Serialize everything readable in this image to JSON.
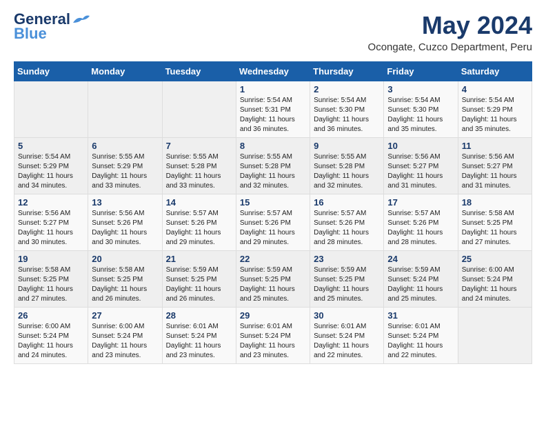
{
  "header": {
    "logo_line1": "General",
    "logo_line2": "Blue",
    "month_year": "May 2024",
    "location": "Ocongate, Cuzco Department, Peru"
  },
  "days_of_week": [
    "Sunday",
    "Monday",
    "Tuesday",
    "Wednesday",
    "Thursday",
    "Friday",
    "Saturday"
  ],
  "weeks": [
    [
      {
        "day": "",
        "info": ""
      },
      {
        "day": "",
        "info": ""
      },
      {
        "day": "",
        "info": ""
      },
      {
        "day": "1",
        "info": "Sunrise: 5:54 AM\nSunset: 5:31 PM\nDaylight: 11 hours\nand 36 minutes."
      },
      {
        "day": "2",
        "info": "Sunrise: 5:54 AM\nSunset: 5:30 PM\nDaylight: 11 hours\nand 36 minutes."
      },
      {
        "day": "3",
        "info": "Sunrise: 5:54 AM\nSunset: 5:30 PM\nDaylight: 11 hours\nand 35 minutes."
      },
      {
        "day": "4",
        "info": "Sunrise: 5:54 AM\nSunset: 5:29 PM\nDaylight: 11 hours\nand 35 minutes."
      }
    ],
    [
      {
        "day": "5",
        "info": "Sunrise: 5:54 AM\nSunset: 5:29 PM\nDaylight: 11 hours\nand 34 minutes."
      },
      {
        "day": "6",
        "info": "Sunrise: 5:55 AM\nSunset: 5:29 PM\nDaylight: 11 hours\nand 33 minutes."
      },
      {
        "day": "7",
        "info": "Sunrise: 5:55 AM\nSunset: 5:28 PM\nDaylight: 11 hours\nand 33 minutes."
      },
      {
        "day": "8",
        "info": "Sunrise: 5:55 AM\nSunset: 5:28 PM\nDaylight: 11 hours\nand 32 minutes."
      },
      {
        "day": "9",
        "info": "Sunrise: 5:55 AM\nSunset: 5:28 PM\nDaylight: 11 hours\nand 32 minutes."
      },
      {
        "day": "10",
        "info": "Sunrise: 5:56 AM\nSunset: 5:27 PM\nDaylight: 11 hours\nand 31 minutes."
      },
      {
        "day": "11",
        "info": "Sunrise: 5:56 AM\nSunset: 5:27 PM\nDaylight: 11 hours\nand 31 minutes."
      }
    ],
    [
      {
        "day": "12",
        "info": "Sunrise: 5:56 AM\nSunset: 5:27 PM\nDaylight: 11 hours\nand 30 minutes."
      },
      {
        "day": "13",
        "info": "Sunrise: 5:56 AM\nSunset: 5:26 PM\nDaylight: 11 hours\nand 30 minutes."
      },
      {
        "day": "14",
        "info": "Sunrise: 5:57 AM\nSunset: 5:26 PM\nDaylight: 11 hours\nand 29 minutes."
      },
      {
        "day": "15",
        "info": "Sunrise: 5:57 AM\nSunset: 5:26 PM\nDaylight: 11 hours\nand 29 minutes."
      },
      {
        "day": "16",
        "info": "Sunrise: 5:57 AM\nSunset: 5:26 PM\nDaylight: 11 hours\nand 28 minutes."
      },
      {
        "day": "17",
        "info": "Sunrise: 5:57 AM\nSunset: 5:26 PM\nDaylight: 11 hours\nand 28 minutes."
      },
      {
        "day": "18",
        "info": "Sunrise: 5:58 AM\nSunset: 5:25 PM\nDaylight: 11 hours\nand 27 minutes."
      }
    ],
    [
      {
        "day": "19",
        "info": "Sunrise: 5:58 AM\nSunset: 5:25 PM\nDaylight: 11 hours\nand 27 minutes."
      },
      {
        "day": "20",
        "info": "Sunrise: 5:58 AM\nSunset: 5:25 PM\nDaylight: 11 hours\nand 26 minutes."
      },
      {
        "day": "21",
        "info": "Sunrise: 5:59 AM\nSunset: 5:25 PM\nDaylight: 11 hours\nand 26 minutes."
      },
      {
        "day": "22",
        "info": "Sunrise: 5:59 AM\nSunset: 5:25 PM\nDaylight: 11 hours\nand 25 minutes."
      },
      {
        "day": "23",
        "info": "Sunrise: 5:59 AM\nSunset: 5:25 PM\nDaylight: 11 hours\nand 25 minutes."
      },
      {
        "day": "24",
        "info": "Sunrise: 5:59 AM\nSunset: 5:24 PM\nDaylight: 11 hours\nand 25 minutes."
      },
      {
        "day": "25",
        "info": "Sunrise: 6:00 AM\nSunset: 5:24 PM\nDaylight: 11 hours\nand 24 minutes."
      }
    ],
    [
      {
        "day": "26",
        "info": "Sunrise: 6:00 AM\nSunset: 5:24 PM\nDaylight: 11 hours\nand 24 minutes."
      },
      {
        "day": "27",
        "info": "Sunrise: 6:00 AM\nSunset: 5:24 PM\nDaylight: 11 hours\nand 23 minutes."
      },
      {
        "day": "28",
        "info": "Sunrise: 6:01 AM\nSunset: 5:24 PM\nDaylight: 11 hours\nand 23 minutes."
      },
      {
        "day": "29",
        "info": "Sunrise: 6:01 AM\nSunset: 5:24 PM\nDaylight: 11 hours\nand 23 minutes."
      },
      {
        "day": "30",
        "info": "Sunrise: 6:01 AM\nSunset: 5:24 PM\nDaylight: 11 hours\nand 22 minutes."
      },
      {
        "day": "31",
        "info": "Sunrise: 6:01 AM\nSunset: 5:24 PM\nDaylight: 11 hours\nand 22 minutes."
      },
      {
        "day": "",
        "info": ""
      }
    ]
  ]
}
